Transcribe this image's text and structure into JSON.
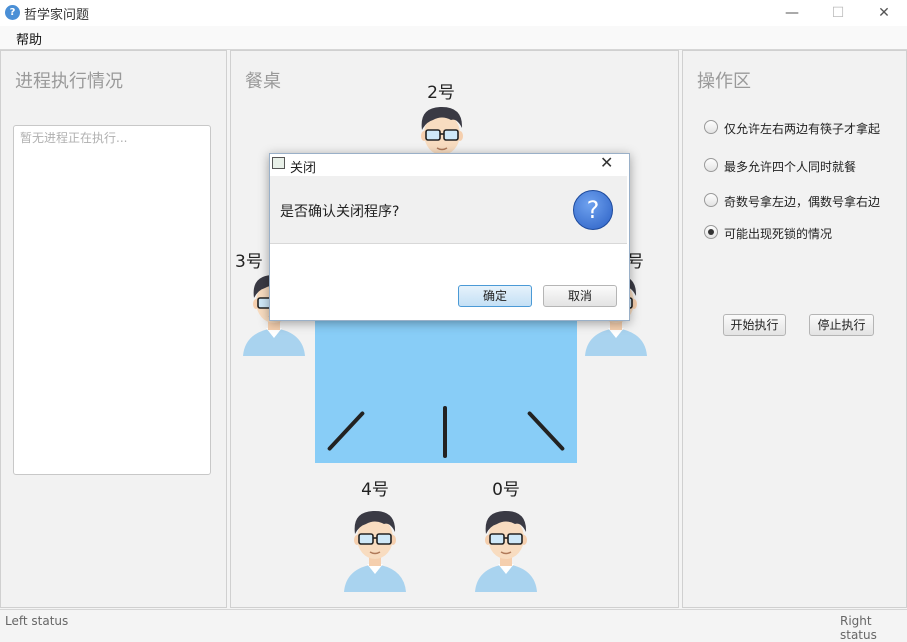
{
  "window": {
    "title": "哲学家问题",
    "minimize": "—",
    "maximize": "☐",
    "close": "✕"
  },
  "menu": {
    "help": "帮助"
  },
  "left": {
    "title": "进程执行情况",
    "log_placeholder": "暂无进程正在执行..."
  },
  "center": {
    "title": "餐桌",
    "seats": [
      {
        "label": "2号"
      },
      {
        "label": "3号"
      },
      {
        "label": "1号"
      },
      {
        "label": "4号"
      },
      {
        "label": "0号"
      }
    ]
  },
  "right": {
    "title": "操作区",
    "options": [
      {
        "label": "仅允许左右两边有筷子才拿起",
        "selected": false
      },
      {
        "label": "最多允许四个人同时就餐",
        "selected": false
      },
      {
        "label": "奇数号拿左边，偶数号拿右边",
        "selected": false
      },
      {
        "label": "可能出现死锁的情况",
        "selected": true
      }
    ],
    "start_button": "开始执行",
    "stop_button": "停止执行"
  },
  "status": {
    "left": "Left status",
    "right": "Right status"
  },
  "dialog": {
    "title": "关闭",
    "message": "是否确认关闭程序?",
    "icon": "question-icon",
    "confirm": "确定",
    "cancel": "取消",
    "close": "✕"
  },
  "colors": {
    "table": "#88cdf7",
    "accent": "#2a5fc4"
  }
}
